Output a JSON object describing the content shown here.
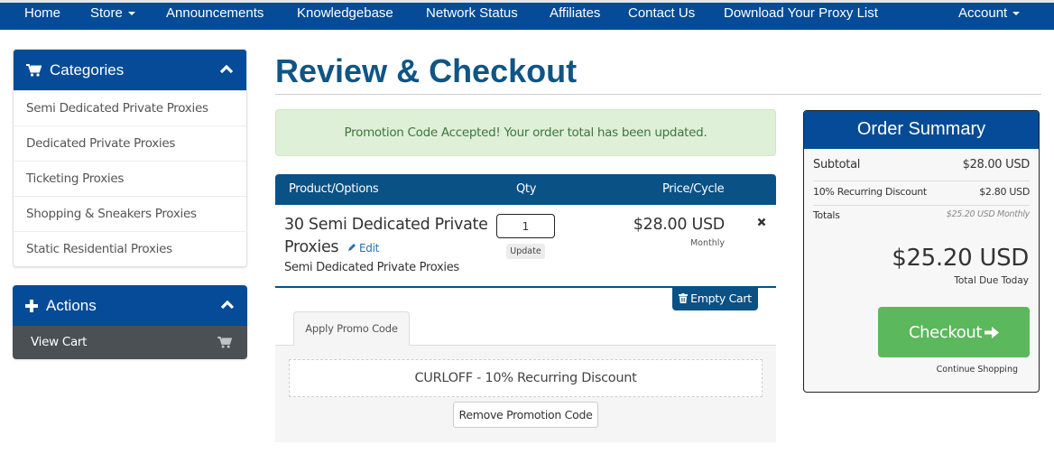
{
  "nav": {
    "items": [
      {
        "label": "Home",
        "has_caret": false
      },
      {
        "label": "Store",
        "has_caret": true
      },
      {
        "label": "Announcements",
        "has_caret": false
      },
      {
        "label": "Knowledgebase",
        "has_caret": false
      },
      {
        "label": "Network Status",
        "has_caret": false
      },
      {
        "label": "Affiliates",
        "has_caret": false
      },
      {
        "label": "Contact Us",
        "has_caret": false
      },
      {
        "label": "Download Your Proxy List",
        "has_caret": false
      }
    ],
    "account_label": "Account"
  },
  "sidebar": {
    "categories": {
      "title": "Categories",
      "icon": "shopping-cart-icon",
      "items": [
        {
          "label": "Semi Dedicated Private Proxies"
        },
        {
          "label": "Dedicated Private Proxies"
        },
        {
          "label": "Ticketing Proxies"
        },
        {
          "label": "Shopping & Sneakers Proxies"
        },
        {
          "label": "Static Residential Proxies"
        }
      ]
    },
    "actions": {
      "title": "Actions",
      "icon": "plus-icon",
      "items": [
        {
          "label": "View Cart",
          "icon": "shopping-cart-icon"
        }
      ]
    }
  },
  "main": {
    "title": "Review & Checkout",
    "alert": "Promotion Code Accepted! Your order total has been updated.",
    "cart": {
      "headers": {
        "product": "Product/Options",
        "qty": "Qty",
        "price": "Price/Cycle"
      },
      "items": [
        {
          "name": "30 Semi Dedicated Private Proxies",
          "edit_label": "Edit",
          "group": "Semi Dedicated Private Proxies",
          "qty": "1",
          "update_label": "Update",
          "price": "$28.00 USD",
          "cycle": "Monthly"
        }
      ],
      "empty_cart_label": "Empty Cart"
    },
    "promo": {
      "tab_label": "Apply Promo Code",
      "applied_code": "CURLOFF - 10% Recurring Discount",
      "remove_label": "Remove Promotion Code"
    }
  },
  "summary": {
    "title": "Order Summary",
    "subtotal_label": "Subtotal",
    "subtotal_value": "$28.00 USD",
    "discount_label": "10% Recurring Discount",
    "discount_value": "$2.80 USD",
    "totals_label": "Totals",
    "totals_value": "$25.20 USD Monthly",
    "total_due": "$25.20 USD",
    "total_due_label": "Total Due Today",
    "checkout_label": "Checkout",
    "continue_label": "Continue Shopping"
  },
  "colors": {
    "nav_bg": "#054b97",
    "table_head": "#0a5186",
    "title": "#0f5585",
    "success_bg": "#dff0d8",
    "success_text": "#3c763d",
    "checkout_green": "#5cb85c",
    "view_cart_bg": "#4b5054"
  }
}
